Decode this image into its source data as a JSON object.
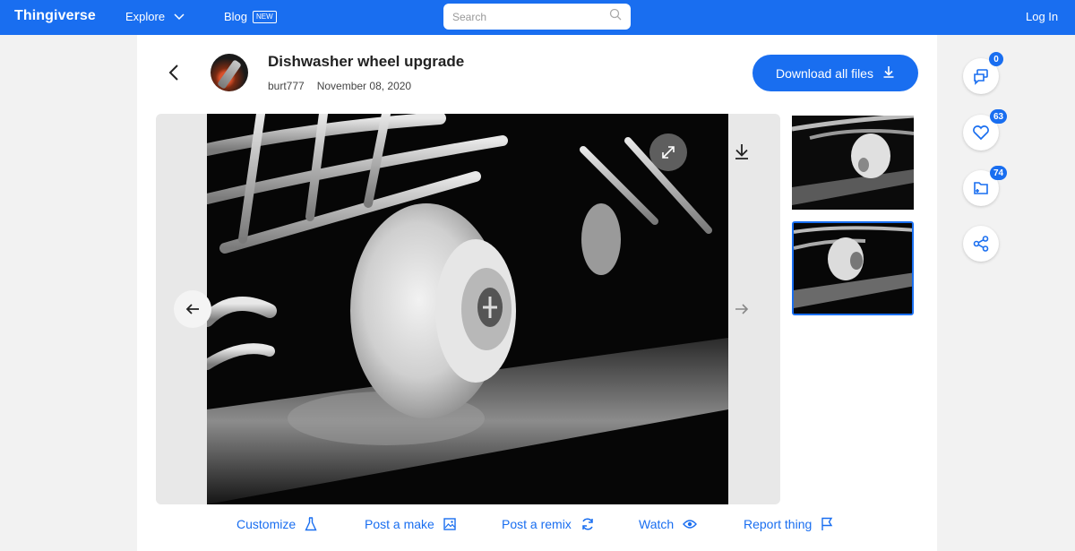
{
  "colors": {
    "brand": "#196ef0",
    "topbar": "#196ef0",
    "panel": "#ffffff",
    "background": "#f2f2f2"
  },
  "topbar": {
    "logo": "Thingiverse",
    "explore_label": "Explore",
    "blog_label": "Blog",
    "blog_badge": "NEW",
    "search_placeholder": "Search",
    "login_label": "Log In"
  },
  "thing": {
    "title": "Dishwasher wheel upgrade",
    "author": "burt777",
    "date": "November 08, 2020",
    "download_all_label": "Download all files"
  },
  "gallery": {
    "thumbnails": [
      {
        "selected": false
      },
      {
        "selected": true
      }
    ]
  },
  "actions": [
    {
      "label": "Customize",
      "icon": "flask-icon"
    },
    {
      "label": "Post a make",
      "icon": "image-icon"
    },
    {
      "label": "Post a remix",
      "icon": "remix-icon"
    },
    {
      "label": "Watch",
      "icon": "eye-icon"
    },
    {
      "label": "Report thing",
      "icon": "flag-icon"
    }
  ],
  "rail": {
    "comments_count": "0",
    "likes_count": "63",
    "collections_count": "74"
  }
}
